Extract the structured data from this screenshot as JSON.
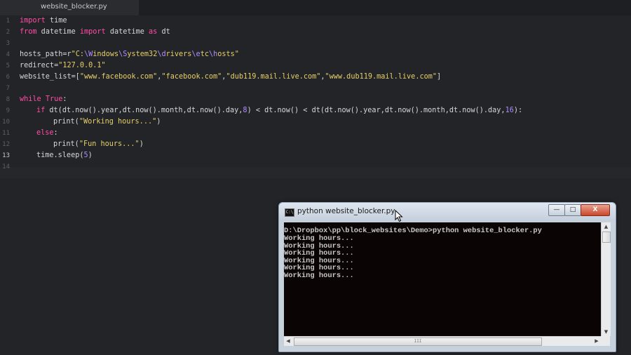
{
  "editor": {
    "tab_label": "website_blocker.py",
    "line_numbers": [
      "1",
      "2",
      "3",
      "4",
      "5",
      "6",
      "7",
      "8",
      "9",
      "10",
      "11",
      "12",
      "13",
      "14"
    ],
    "active_line": "13"
  },
  "terminal": {
    "title": "python  website_blocker.py",
    "icon_label": "C:\\",
    "minimize_label": "—",
    "maximize_label": "□",
    "close_label": "X",
    "lines": [
      "D:\\Dropbox\\pp\\block_websites\\Demo>python website_blocker.py",
      "Working hours...",
      "Working hours...",
      "Working hours...",
      "Working hours...",
      "Working hours...",
      "Working hours..."
    ],
    "hscroll_grip": "III"
  },
  "code": {
    "l1": {
      "k1": "import",
      "t1": " time"
    },
    "l2": {
      "k1": "from",
      "t1": " datetime ",
      "k2": "import",
      "t2": " datetime ",
      "k3": "as",
      "t3": " dt"
    },
    "l4": {
      "t1": "hosts_path=r",
      "s1": "\"C:",
      "e1": "\\W",
      "s2": "indows",
      "e2": "\\S",
      "s3": "ystem32",
      "e3": "\\d",
      "s4": "rivers",
      "e4": "\\e",
      "s5": "tc",
      "e5": "\\h",
      "s6": "osts\""
    },
    "l5": {
      "t1": "redirect=",
      "s1": "\"127.0.0.1\""
    },
    "l6": {
      "t1": "website_list=[",
      "s1": "\"www.facebook.com\"",
      "c1": ",",
      "s2": "\"facebook.com\"",
      "c2": ",",
      "s3": "\"dub119.mail.live.com\"",
      "c3": ",",
      "s4": "\"www.dub119.mail.live.com\"",
      "t2": "]"
    },
    "l8": {
      "k1": "while",
      "t1": " ",
      "k2": "True",
      "t2": ":"
    },
    "l9": {
      "k1": "if",
      "t1": " dt(dt.now().year,dt.now().month,dt.now().day,",
      "n1": "8",
      "t2": ") < dt.now() < dt(dt.now().year,dt.now().month,dt.now().day,",
      "n2": "16",
      "t3": "):"
    },
    "l10": {
      "t1": "print(",
      "s1": "\"Working hours...\"",
      "t2": ")"
    },
    "l11": {
      "k1": "else",
      "t1": ":"
    },
    "l12": {
      "t1": "print(",
      "s1": "\"Fun hours...\"",
      "t2": ")"
    },
    "l13": {
      "t1": "time.sleep(",
      "n1": "5",
      "t2": ")"
    }
  }
}
